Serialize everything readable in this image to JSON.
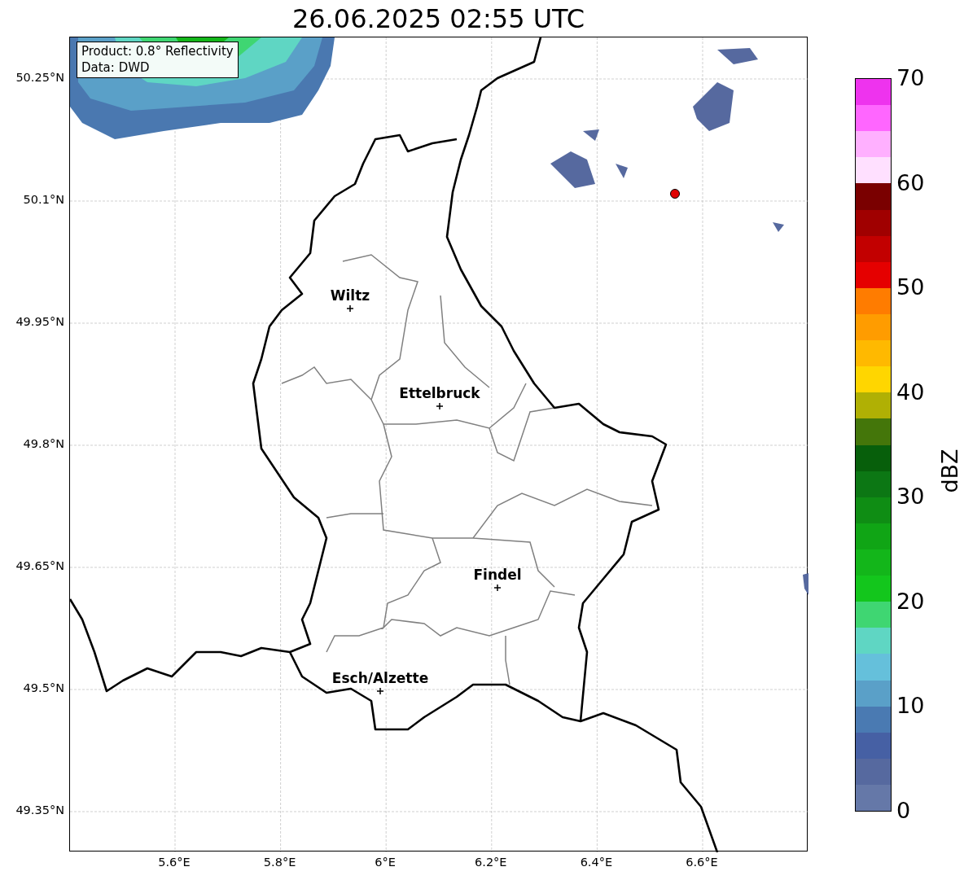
{
  "title": "26.06.2025 02:55 UTC",
  "info_box": {
    "lines": [
      "Product: 0.8° Reflectivity",
      "Data: DWD"
    ]
  },
  "map": {
    "y_ticks": [
      "50.25°N",
      "50.1°N",
      "49.95°N",
      "49.8°N",
      "49.65°N",
      "49.5°N",
      "49.35°N"
    ],
    "x_ticks": [
      "5.6°E",
      "5.8°E",
      "6°E",
      "6.2°E",
      "6.4°E",
      "6.6°E"
    ],
    "cities": [
      {
        "name": "Wiltz"
      },
      {
        "name": "Ettelbruck"
      },
      {
        "name": "Findel"
      },
      {
        "name": "Esch/Alzette"
      }
    ]
  },
  "colorbar": {
    "label": "dBZ",
    "ticks": [
      "70",
      "60",
      "50",
      "40",
      "30",
      "20",
      "10",
      "0"
    ],
    "bins": [
      {
        "color": "#ee33ee"
      },
      {
        "color": "#ff66ff"
      },
      {
        "color": "#ffb0ff"
      },
      {
        "color": "#ffe0ff"
      },
      {
        "color": "#7a0000"
      },
      {
        "color": "#a00000"
      },
      {
        "color": "#c20000"
      },
      {
        "color": "#e50000"
      },
      {
        "color": "#ff7c00"
      },
      {
        "color": "#ff9c00"
      },
      {
        "color": "#ffb900"
      },
      {
        "color": "#ffd600"
      },
      {
        "color": "#b0b004"
      },
      {
        "color": "#44760a"
      },
      {
        "color": "#075f0b"
      },
      {
        "color": "#0c7714"
      },
      {
        "color": "#0f8d14"
      },
      {
        "color": "#10a515"
      },
      {
        "color": "#13b61a"
      },
      {
        "color": "#13c61c"
      },
      {
        "color": "#3fd672"
      },
      {
        "color": "#5fd6c3"
      },
      {
        "color": "#65c0db"
      },
      {
        "color": "#5aa0c8"
      },
      {
        "color": "#4a7ab2"
      },
      {
        "color": "#4660a4"
      },
      {
        "color": "#56699f"
      },
      {
        "color": "#6578a8"
      }
    ]
  }
}
